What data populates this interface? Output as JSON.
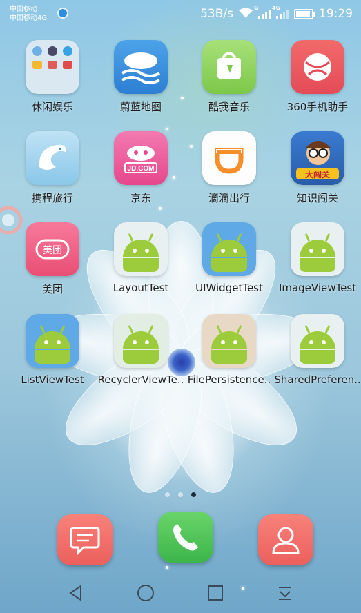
{
  "status_bar": {
    "carrier_line1": "中国移动",
    "carrier_line2": "中国移动4G",
    "net_speed": "53B/s",
    "signal1_label": "G",
    "signal2_label": "4G",
    "battery_level": 0.85,
    "time": "19:29"
  },
  "apps": [
    {
      "label": "休闲娱乐",
      "icon": "folder-icon"
    },
    {
      "label": "蔚蓝地图",
      "icon": "blue-map-icon"
    },
    {
      "label": "酷我音乐",
      "icon": "kuwo-music-icon"
    },
    {
      "label": "360手机助手",
      "icon": "360-assistant-icon"
    },
    {
      "label": "携程旅行",
      "icon": "ctrip-dolphin-icon"
    },
    {
      "label": "京东",
      "icon": "jd-icon"
    },
    {
      "label": "滴滴出行",
      "icon": "didi-icon"
    },
    {
      "label": "知识闯关",
      "icon": "quiz-game-icon"
    },
    {
      "label": "美团",
      "icon": "meituan-icon"
    },
    {
      "label": "LayoutTest",
      "icon": "android-icon"
    },
    {
      "label": "UIWidgetTest",
      "icon": "android-icon"
    },
    {
      "label": "ImageViewTest",
      "icon": "android-icon"
    },
    {
      "label": "ListViewTest",
      "icon": "android-icon"
    },
    {
      "label": "RecyclerViewTe..",
      "icon": "android-icon"
    },
    {
      "label": "FilePersistence..",
      "icon": "android-icon"
    },
    {
      "label": "SharedPreferen..",
      "icon": "android-icon"
    }
  ],
  "icon_text": {
    "jd": "JD.COM",
    "meituan": "美团",
    "quiz": "大闯关"
  },
  "page_indicator": {
    "count": 3,
    "active": 3
  },
  "dock": [
    {
      "icon": "messages-icon"
    },
    {
      "icon": "phone-icon"
    },
    {
      "icon": "contacts-icon"
    }
  ],
  "nav": [
    {
      "icon": "back-icon"
    },
    {
      "icon": "home-icon"
    },
    {
      "icon": "recents-icon"
    },
    {
      "icon": "notification-pulldown-icon"
    }
  ],
  "colors": {
    "android_green": "#9ccc3c",
    "dock_red": "#f06f6a",
    "dock_green": "#4cc44f"
  }
}
